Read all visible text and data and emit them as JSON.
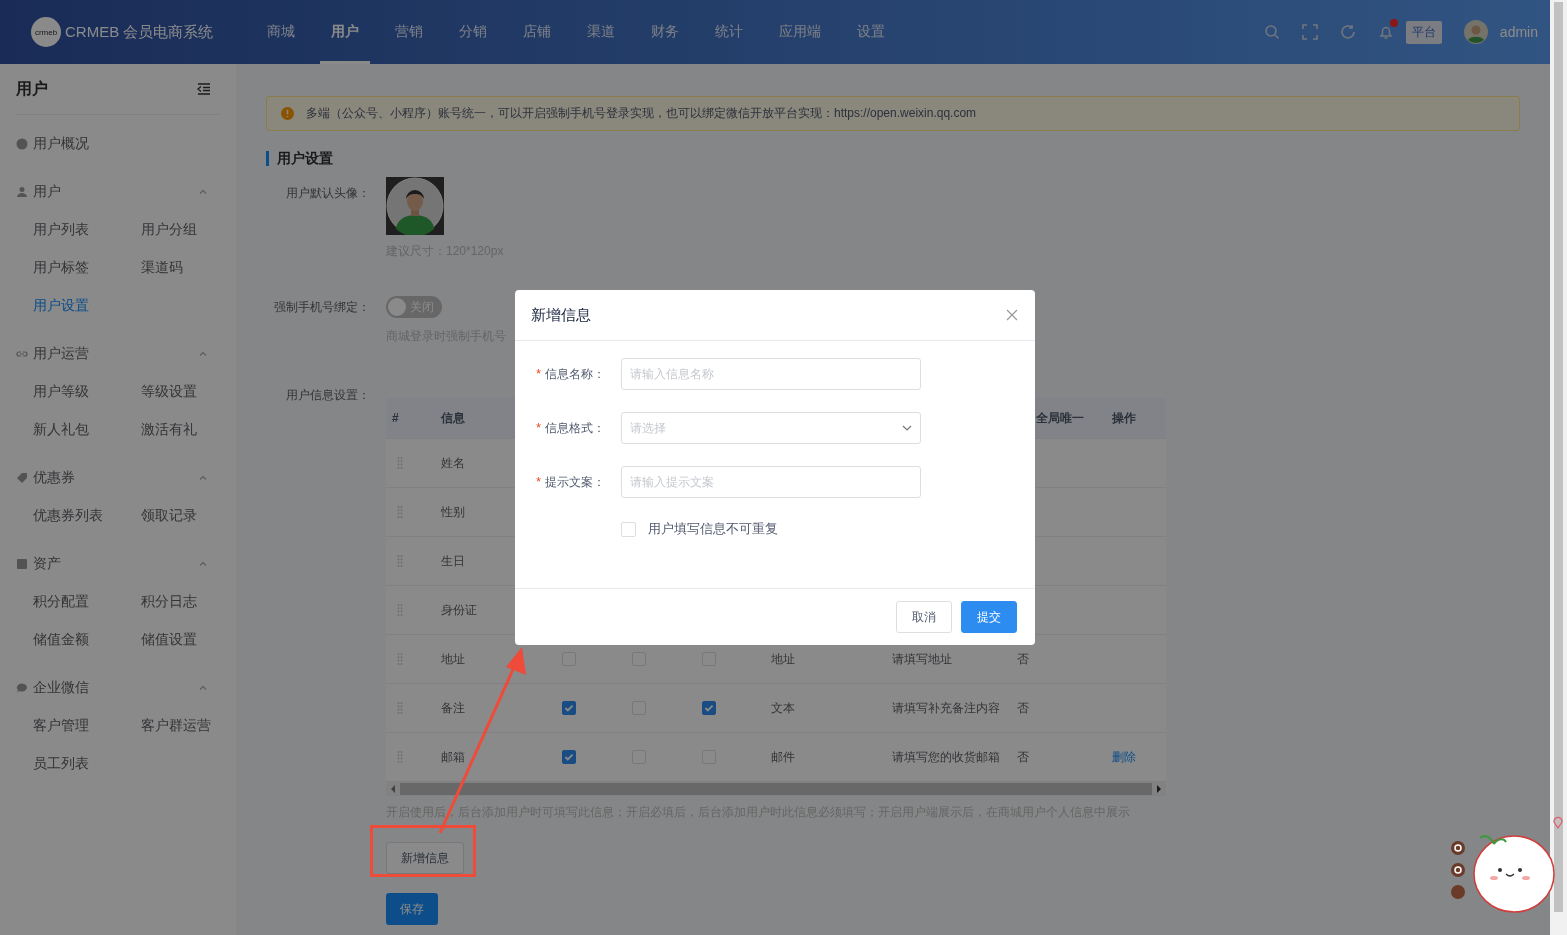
{
  "topbar": {
    "logo_mark": "crmeb",
    "brand": "CRMEB 会员电商系统",
    "nav": [
      {
        "label": "商城",
        "selected": false
      },
      {
        "label": "用户",
        "selected": true
      },
      {
        "label": "营销",
        "selected": false
      },
      {
        "label": "分销",
        "selected": false
      },
      {
        "label": "店铺",
        "selected": false
      },
      {
        "label": "渠道",
        "selected": false
      },
      {
        "label": "财务",
        "selected": false
      },
      {
        "label": "统计",
        "selected": false
      },
      {
        "label": "应用端",
        "selected": false
      },
      {
        "label": "设置",
        "selected": false
      }
    ],
    "notification_dot": true,
    "platform_badge": "平台",
    "username": "admin"
  },
  "sidebar": {
    "title": "用户",
    "groups": [
      {
        "label": "用户概况"
      },
      {
        "label": "用户",
        "expanded": true,
        "items": [
          {
            "label": "用户列表",
            "selected": false
          },
          {
            "label": "用户分组",
            "selected": false
          },
          {
            "label": "用户标签",
            "selected": false
          },
          {
            "label": "渠道码",
            "selected": false
          },
          {
            "label": "用户设置",
            "selected": true
          }
        ]
      },
      {
        "label": "用户运营",
        "expanded": true,
        "items": [
          {
            "label": "用户等级",
            "selected": false
          },
          {
            "label": "等级设置",
            "selected": false
          },
          {
            "label": "新人礼包",
            "selected": false
          },
          {
            "label": "激活有礼",
            "selected": false
          }
        ]
      },
      {
        "label": "优惠券",
        "expanded": true,
        "items": [
          {
            "label": "优惠券列表",
            "selected": false
          },
          {
            "label": "领取记录",
            "selected": false
          }
        ]
      },
      {
        "label": "资产",
        "expanded": true,
        "items": [
          {
            "label": "积分配置",
            "selected": false
          },
          {
            "label": "积分日志",
            "selected": false
          },
          {
            "label": "储值金额",
            "selected": false
          },
          {
            "label": "储值设置",
            "selected": false
          }
        ]
      },
      {
        "label": "企业微信",
        "expanded": true,
        "items": [
          {
            "label": "客户管理",
            "selected": false
          },
          {
            "label": "客户群运营",
            "selected": false
          },
          {
            "label": "员工列表",
            "selected": false
          }
        ]
      }
    ]
  },
  "content": {
    "alert": "多端（公众号、小程序）账号统一，可以开启强制手机号登录实现，也可以绑定微信开放平台实现：https://open.weixin.qq.com",
    "section_title": "用户设置",
    "avatar": {
      "label": "用户默认头像：",
      "hint": "建议尺寸：120*120px"
    },
    "phone_binding": {
      "label": "强制手机号绑定：",
      "on": false,
      "switch_text": "关闭",
      "hint": "商城登录时强制手机号"
    },
    "info_settings": {
      "label": "用户信息设置："
    },
    "table": {
      "columns": [
        "#",
        "信息",
        "全局唯一",
        "操作"
      ],
      "rows": [
        {
          "name": "姓名"
        },
        {
          "name": "性别"
        },
        {
          "name": "生日"
        },
        {
          "name": "身份证"
        },
        {
          "name": "地址",
          "checks": [
            false,
            false,
            false
          ],
          "type": "地址",
          "hint": "请填写地址",
          "unique": "否"
        },
        {
          "name": "备注",
          "checks": [
            true,
            false,
            true
          ],
          "type": "文本",
          "hint": "请填写补充备注内容",
          "unique": "否"
        },
        {
          "name": "邮箱",
          "checks": [
            true,
            false,
            false
          ],
          "type": "邮件",
          "hint": "请填写您的收货邮箱",
          "unique": "否",
          "action": "删除"
        }
      ]
    },
    "note": "开启使用后，后台添加用户时可填写此信息；开启必填后，后台添加用户时此信息必须填写；开启用户端展示后，在商城用户个人信息中展示",
    "add_button": "新增信息",
    "save_button": "保存"
  },
  "modal": {
    "title": "新增信息",
    "required_mark": "*",
    "fields": [
      {
        "kind": "input",
        "label": "信息名称：",
        "required": true,
        "placeholder": "请输入信息名称"
      },
      {
        "kind": "select",
        "label": "信息格式：",
        "required": true,
        "placeholder": "请选择"
      },
      {
        "kind": "input",
        "label": "提示文案：",
        "required": true,
        "placeholder": "请输入提示文案"
      }
    ],
    "checkbox": {
      "label": "用户填写信息不可重复",
      "checked": false
    },
    "buttons": [
      {
        "kind": "cancel",
        "label": "取消"
      },
      {
        "kind": "submit",
        "label": "提交"
      }
    ]
  }
}
